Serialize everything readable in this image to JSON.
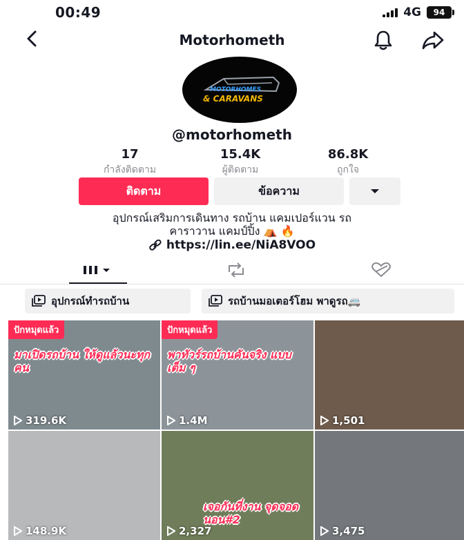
{
  "status_bar": {
    "time": "00:49",
    "network": "4G",
    "battery": "94"
  },
  "nav": {
    "title": "Motorhometh",
    "back_icon": "chevron-left-icon",
    "bell_icon": "bell-icon",
    "share_icon": "share-arrow-icon"
  },
  "profile": {
    "logo_line1": "MOTORHOMES",
    "logo_line2": "& CARAVANS",
    "username": "@motorhometh",
    "stats": [
      {
        "value": "17",
        "label": "กำลังติดตาม"
      },
      {
        "value": "15.4K",
        "label": "ผู้ติดตาม"
      },
      {
        "value": "86.8K",
        "label": "ถูกใจ"
      }
    ],
    "follow_label": "ติดตาม",
    "message_label": "ข้อความ",
    "bio_line1": "อุปกรณ์เสริมการเดินทาง รถบ้าน แคมเปอร์แวน รถ",
    "bio_line2": "คาราวาน แคมป์ปิ้ง ⛺ 🔥",
    "link": "https://lin.ee/NiA8VOO"
  },
  "tabs": [
    "videos-grid-icon",
    "repost-icon",
    "liked-heart-icon"
  ],
  "playlists": [
    {
      "label": "อุปกรณ์ทำรถบ้าน",
      "icon": "playlist-icon"
    },
    {
      "label": "รถบ้านมอเตอร์โฮม พาดูรถ🚐",
      "icon": "playlist-icon"
    }
  ],
  "videos": [
    {
      "pinned": "ปักหมุดแล้ว",
      "caption": "มาเปิดรถบ้าน ให้ดูแล้วนะทุกคน",
      "views": "319.6K",
      "bg": "#7f8a8f"
    },
    {
      "pinned": "ปักหมุดแล้ว",
      "caption": "พาทัวร์รถบ้านคันจริง แบบเต็ม ๆ",
      "views": "1.4M",
      "bg": "#8d9499"
    },
    {
      "pinned": "",
      "caption": "",
      "views": "1,501",
      "bg": "#6e5b4c"
    },
    {
      "pinned": "",
      "caption": "",
      "views": "148.9K",
      "bg": "#b7b9bb"
    },
    {
      "pinned": "",
      "caption": "เจอกันที่งาน จุดจอดนอน#2",
      "views": "2,327",
      "bg": "#6f7d5a"
    },
    {
      "pinned": "",
      "caption": "",
      "views": "3,475",
      "bg": "#74787c"
    }
  ]
}
